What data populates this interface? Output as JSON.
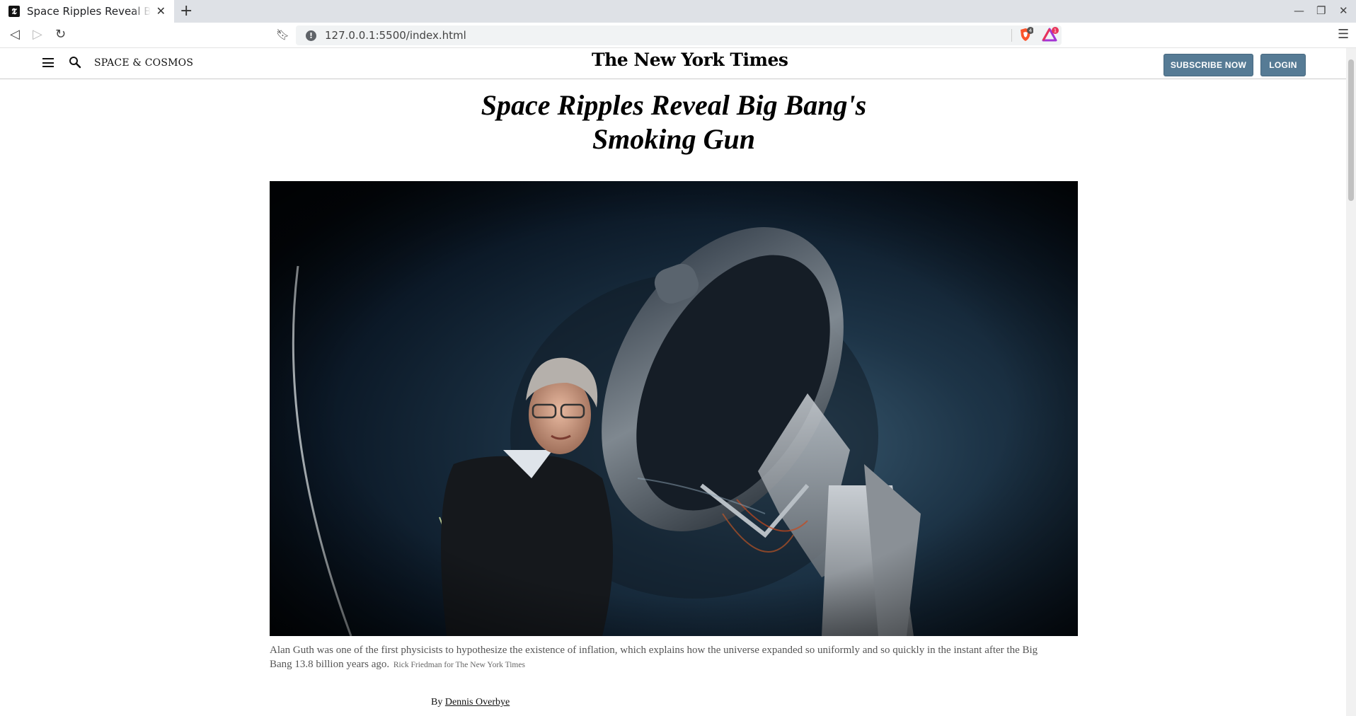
{
  "browser": {
    "tab_title": "Space Ripples Reveal Big Bang's Smoking Gun",
    "tab_favicon": "nyt-t",
    "url": "127.0.0.1:5500/index.html",
    "shield_count": "4",
    "rewards_count": "1"
  },
  "header": {
    "section": "SPACE & COSMOS",
    "logo": "The New York Times",
    "subscribe_label": "SUBSCRIBE NOW",
    "login_label": "LOGIN"
  },
  "article": {
    "headline_line1": "Space Ripples Reveal Big Bang's",
    "headline_line2": "Smoking Gun",
    "caption": "Alan Guth was one of the first physicists to hypothesize the existence of inflation, which explains how the universe expanded so uniformly and so quickly in the instant after the Big Bang 13.8 billion years ago.",
    "photo_credit": "Rick Friedman for The New York Times",
    "byline_prefix": "By",
    "author": "Dennis Overbye"
  },
  "colors": {
    "button_bg": "#567b95",
    "tab_bar": "#dee1e6"
  }
}
